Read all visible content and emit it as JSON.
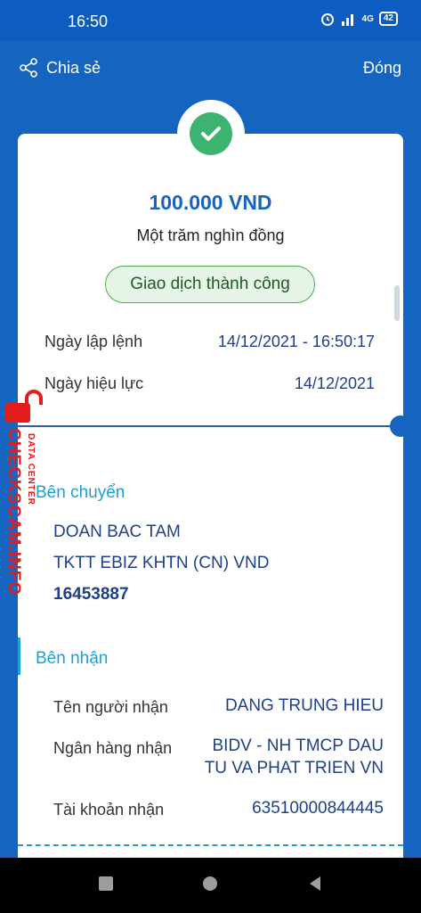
{
  "status_bar": {
    "time": "16:50",
    "network": "4G",
    "battery": "42"
  },
  "header": {
    "share_label": "Chia sẻ",
    "close_label": "Đóng"
  },
  "receipt": {
    "amount": "100.000 VND",
    "amount_in_words": "Một trăm nghìn đồng",
    "status": "Giao dịch thành công",
    "created_label": "Ngày lập lệnh",
    "created_value": "14/12/2021 - 16:50:17",
    "effective_label": "Ngày hiệu lực",
    "effective_value": "14/12/2021"
  },
  "sender": {
    "title": "Bên chuyển",
    "name": "DOAN BAC TAM",
    "account_type": "TKTT EBIZ KHTN (CN) VND",
    "account_number": "16453887"
  },
  "receiver": {
    "title": "Bên nhận",
    "name_label": "Tên người nhận",
    "name_value": "DANG TRUNG HIEU",
    "bank_label": "Ngân hàng nhận",
    "bank_value_line1": "BIDV - NH TMCP DAU",
    "bank_value_line2": "TU VA PHAT TRIEN VN",
    "account_label": "Tài khoản nhận",
    "account_value": "63510000844445"
  },
  "watermark": {
    "site": "CHECKSCAM.INFO",
    "caption": "DATA CENTER"
  },
  "colors": {
    "primary": "#1565c0",
    "success": "#3cb371",
    "accent": "#1e9ed6",
    "text_value": "#1e3f8a",
    "watermark": "#e21b1b"
  }
}
